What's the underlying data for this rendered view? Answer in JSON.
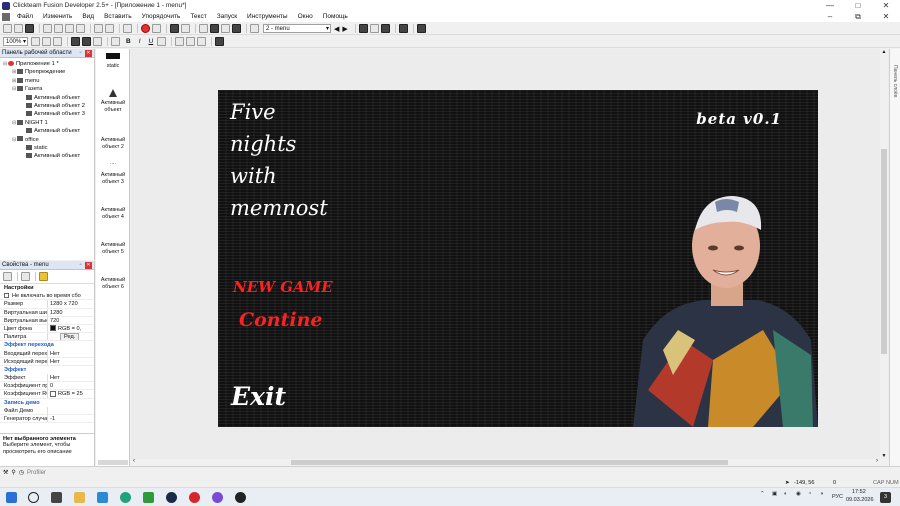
{
  "window": {
    "title": "Clickteam Fusion Developer 2.5+ - [Приложение 1 - menu*]",
    "controls": [
      "—",
      "□",
      "✕"
    ]
  },
  "menubar": {
    "items": [
      "Файл",
      "Изменить",
      "Вид",
      "Вставить",
      "Упорядочить",
      "Текст",
      "Запуск",
      "Инструменты",
      "Окно",
      "Помощь"
    ],
    "doc_controls": [
      "–",
      "⧉",
      "✕"
    ]
  },
  "toolbar1": {
    "frame_combo": "2 - menu"
  },
  "toolbar2": {
    "zoom": "100%",
    "text_buttons": [
      "B",
      "I",
      "U"
    ]
  },
  "workspace": {
    "title": "Панель рабочей области",
    "tree": [
      {
        "label": "Приложение 1 *",
        "indent": 0,
        "expander": "⊟"
      },
      {
        "label": "Препреждение",
        "indent": 1,
        "expander": "⊞"
      },
      {
        "label": "menu",
        "indent": 1,
        "expander": "⊞"
      },
      {
        "label": "Газета",
        "indent": 1,
        "expander": "⊟"
      },
      {
        "label": "Активный объект",
        "indent": 2,
        "expander": ""
      },
      {
        "label": "Активный объект 2",
        "indent": 2,
        "expander": ""
      },
      {
        "label": "Активный объект 3",
        "indent": 2,
        "expander": ""
      },
      {
        "label": "NIGHT 1",
        "indent": 1,
        "expander": "⊟"
      },
      {
        "label": "Активный объект",
        "indent": 2,
        "expander": ""
      },
      {
        "label": "office",
        "indent": 1,
        "expander": "⊟"
      },
      {
        "label": "static",
        "indent": 2,
        "expander": ""
      },
      {
        "label": "Активный объект",
        "indent": 2,
        "expander": ""
      }
    ]
  },
  "properties": {
    "title": "Свойства - menu",
    "section": "Настройки",
    "rows": [
      {
        "type": "check",
        "key": "Не включать во время сбо",
        "value": ""
      },
      {
        "type": "row",
        "key": "Размер",
        "value": "1280 x 720"
      },
      {
        "type": "row",
        "key": "Виртуальная шир",
        "value": "1280"
      },
      {
        "type": "row",
        "key": "Виртуальная выс",
        "value": "720"
      },
      {
        "type": "row",
        "key": "Цвет фона",
        "value": "RGB = 0,"
      },
      {
        "type": "row",
        "key": "Палитра",
        "value": "Ред."
      },
      {
        "type": "cat",
        "key": "Эффект перехода",
        "value": ""
      },
      {
        "type": "row",
        "key": "Входящий перех",
        "value": "Нет"
      },
      {
        "type": "row",
        "key": "Исходящий пере",
        "value": "Нет"
      },
      {
        "type": "cat",
        "key": "Эффект",
        "value": ""
      },
      {
        "type": "row",
        "key": "Эффект",
        "value": "Нет"
      },
      {
        "type": "row",
        "key": "Коэффициент пр",
        "value": "0"
      },
      {
        "type": "row",
        "key": "Коэффициент RG",
        "value": "RGB = 25"
      },
      {
        "type": "cat",
        "key": "Запись демо",
        "value": ""
      },
      {
        "type": "row",
        "key": "Файл Демо",
        "value": ""
      },
      {
        "type": "row",
        "key": "Генератор случа",
        "value": "-1"
      }
    ],
    "help_title": "Нет выбранного элемента",
    "help_text": "Выберите элемент, чтобы просмотреть его описание"
  },
  "objects": [
    {
      "label": "static"
    },
    {
      "label": "Активный объект"
    },
    {
      "label": "Активный объект 2"
    },
    {
      "label": "Активный объект 3"
    },
    {
      "label": "Активный объект 4"
    },
    {
      "label": "Активный объект 5"
    },
    {
      "label": "Активный объект 6"
    }
  ],
  "frame": {
    "title_lines": [
      "Five",
      "nights",
      "with",
      "memnost"
    ],
    "beta": "beta v0.1",
    "new_game": "NEW GAME",
    "continue": "Contine",
    "exit": "Exit"
  },
  "right_strip": {
    "label": "Панель слоёв"
  },
  "status": {
    "profiler": "Profiler",
    "coords": "-149, 56",
    "count": "0",
    "keys": "CAP  NUM"
  },
  "taskbar": {
    "lang": "РУС",
    "time": "17:52",
    "date": "09.03.2026",
    "notif": "3"
  },
  "colors": {
    "frame_bg": "#111111",
    "menu_red": "#ff2020",
    "panel_header": "#dce6f4"
  }
}
